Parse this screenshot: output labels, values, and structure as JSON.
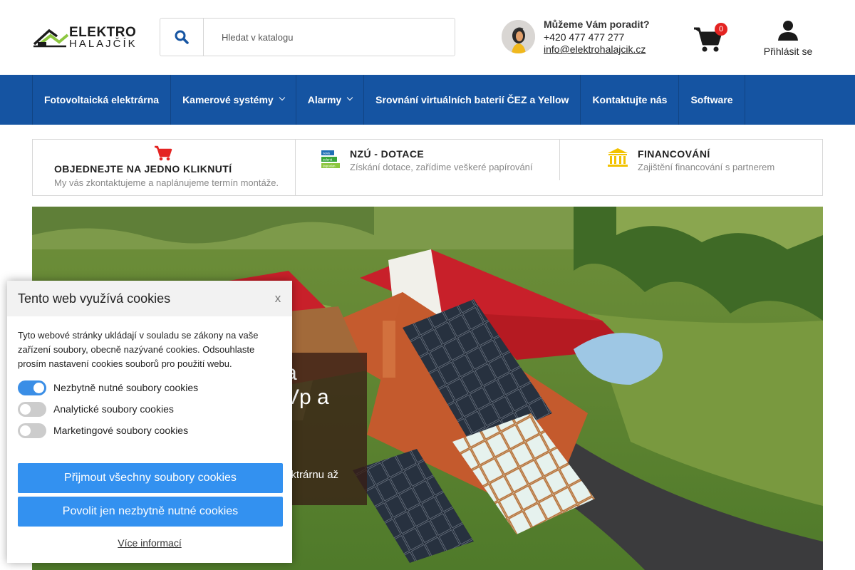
{
  "header": {
    "logo_top": "ELEKTRO",
    "logo_bottom": "HALAJČÍK",
    "search_placeholder": "Hledat v katalogu",
    "advisor_title": "Můžeme Vám poradit?",
    "advisor_phone": "+420 477 477 277",
    "advisor_email": "info@elektrohalajcik.cz",
    "cart_count": "0",
    "login_label": "Přihlásit se",
    "colors": {
      "brand_green": "#8cc63f",
      "brand_blue": "#1554a2",
      "badge_red": "#e42422"
    }
  },
  "nav": {
    "items": [
      {
        "label": "Fotovoltaická elektrárna",
        "has_dropdown": false
      },
      {
        "label": "Kamerové systémy",
        "has_dropdown": true
      },
      {
        "label": "Alarmy",
        "has_dropdown": true
      },
      {
        "label": "Srovnání virtuálních baterií ČEZ a Yellow",
        "has_dropdown": false
      },
      {
        "label": "Kontaktujte nás",
        "has_dropdown": false
      },
      {
        "label": "Software",
        "has_dropdown": false
      }
    ]
  },
  "features": [
    {
      "title": "OBJEDNEJTE NA JEDNO KLIKNUTÍ",
      "subtitle": "My vás zkontaktujeme a naplánujeme termín montáže.",
      "icon": "cart-icon"
    },
    {
      "title": "NZÚ - DOTACE",
      "subtitle": "Získání dotace, zařídime veškeré papírování",
      "icon": "nzu-logo-icon",
      "icon_text": [
        "nová",
        "zelená",
        "úsporám"
      ]
    },
    {
      "title": "FINANCOVÁNÍ",
      "subtitle": "Zajištění financování s partnerem",
      "icon": "bank-icon"
    }
  ],
  "hero": {
    "line1": "a",
    "line2": "Vp a",
    "small": "ektrárnu až"
  },
  "cookie": {
    "title": "Tento web využívá cookies",
    "close": "x",
    "text": "Tyto webové stránky ukládají v souladu se zákony na vaše zařízení soubory, obecně nazývané cookies. Odsouhlaste prosím nastavení cookies souborů pro použití webu.",
    "toggles": [
      {
        "label": "Nezbytně nutné soubory cookies",
        "on": true
      },
      {
        "label": "Analytické soubory cookies",
        "on": false
      },
      {
        "label": "Marketingové soubory cookies",
        "on": false
      }
    ],
    "accept_all": "Přijmout všechny soubory cookies",
    "accept_necessary": "Povolit jen nezbytně nutné cookies",
    "more_info": "Více informací",
    "colors": {
      "button": "#3391f0",
      "toggle_on": "#3a8ee6",
      "toggle_off": "#cccccc"
    }
  }
}
